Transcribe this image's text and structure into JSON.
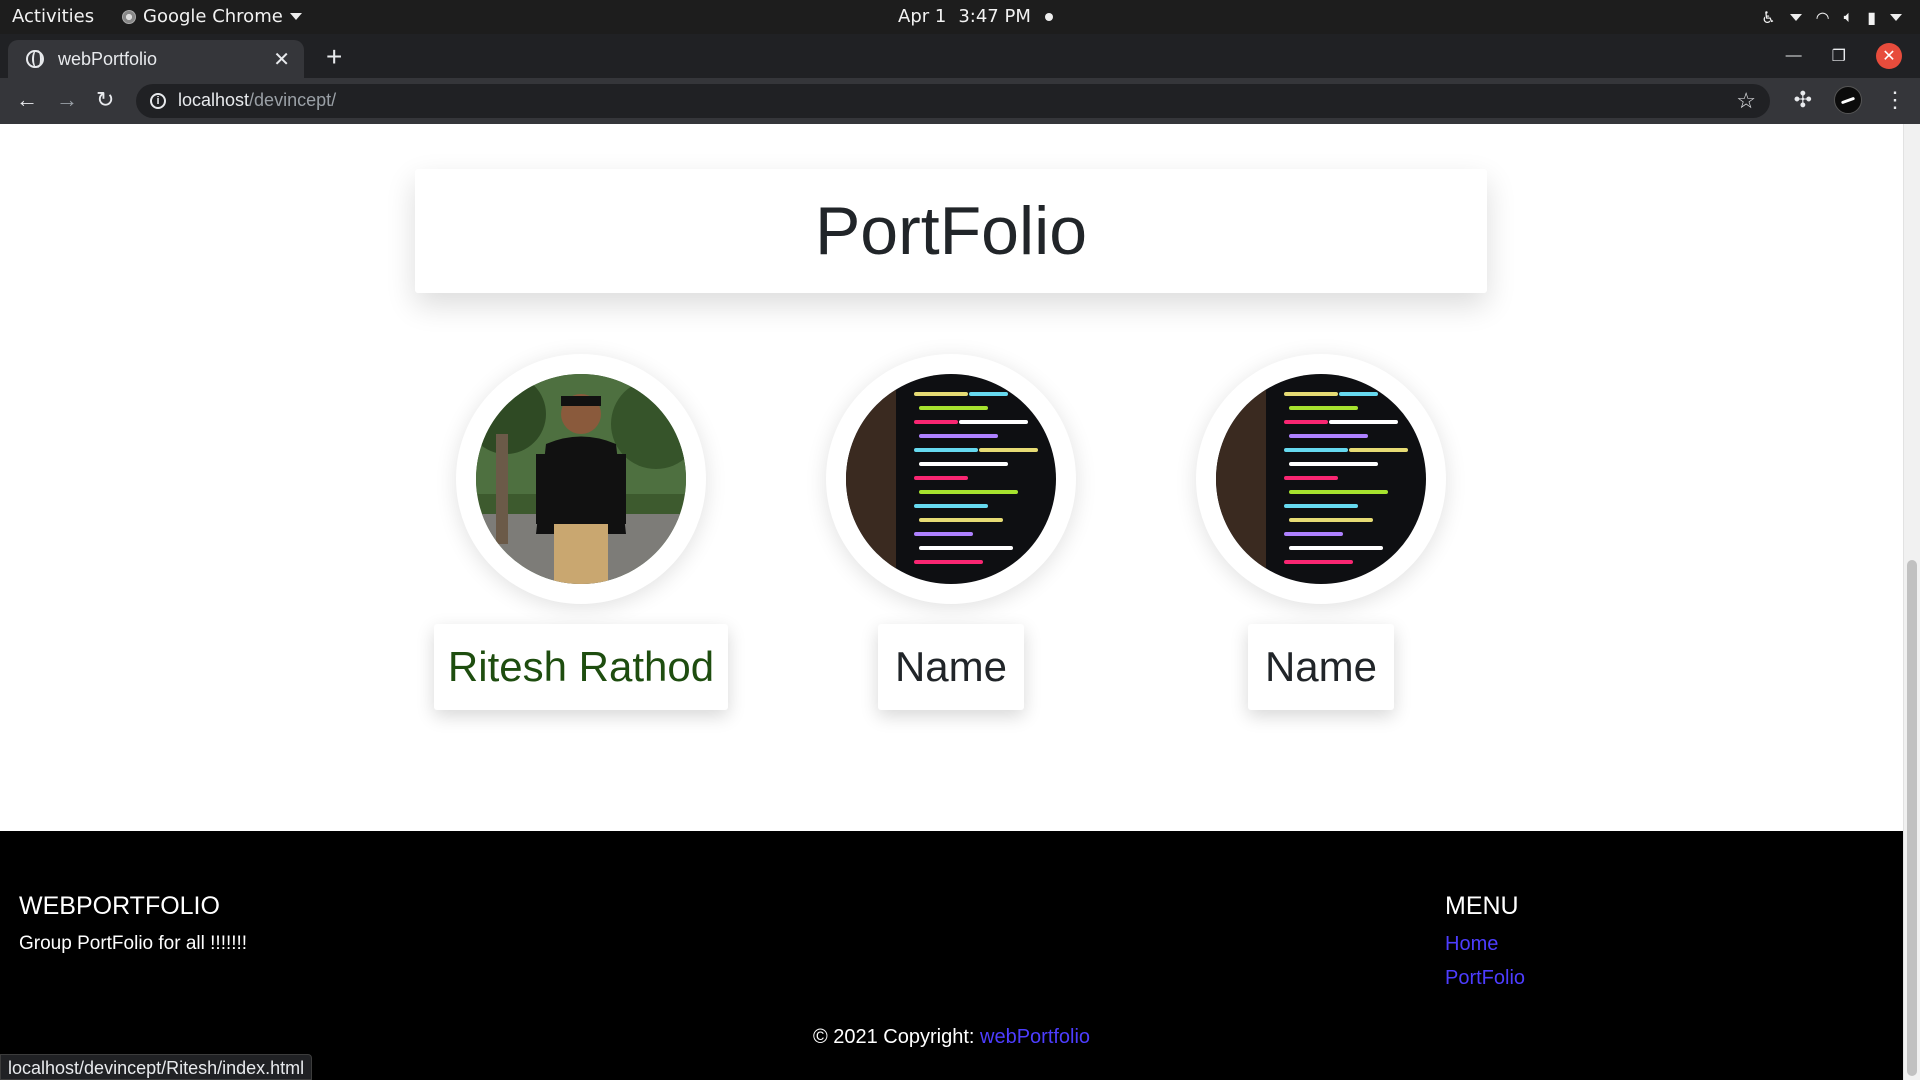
{
  "system_bar": {
    "activities": "Activities",
    "app_name": "Google Chrome",
    "date": "Apr 1",
    "time": "3:47 PM"
  },
  "browser": {
    "tab_title": "webPortfolio",
    "url_host": "localhost",
    "url_path": "/devincept/"
  },
  "page": {
    "heading": "PortFolio",
    "members": [
      {
        "name": "Ritesh Rathod",
        "name_color": "#1e4d0f",
        "photo": "person-photo"
      },
      {
        "name": "Name",
        "name_color": "#212529",
        "photo": "code-screen-photo"
      },
      {
        "name": "Name",
        "name_color": "#212529",
        "photo": "code-screen-photo"
      }
    ]
  },
  "footer": {
    "brand": "WEBPORTFOLIO",
    "description": "Group PortFolio for all !!!!!!!",
    "menu_title": "MENU",
    "menu_items": [
      "Home",
      "PortFolio"
    ],
    "copyright_prefix": "© 2021 Copyright:",
    "copyright_link": "webPortfolio",
    "link_color": "#4d3dff"
  },
  "status_tip": "localhost/devincept/Ritesh/index.html"
}
